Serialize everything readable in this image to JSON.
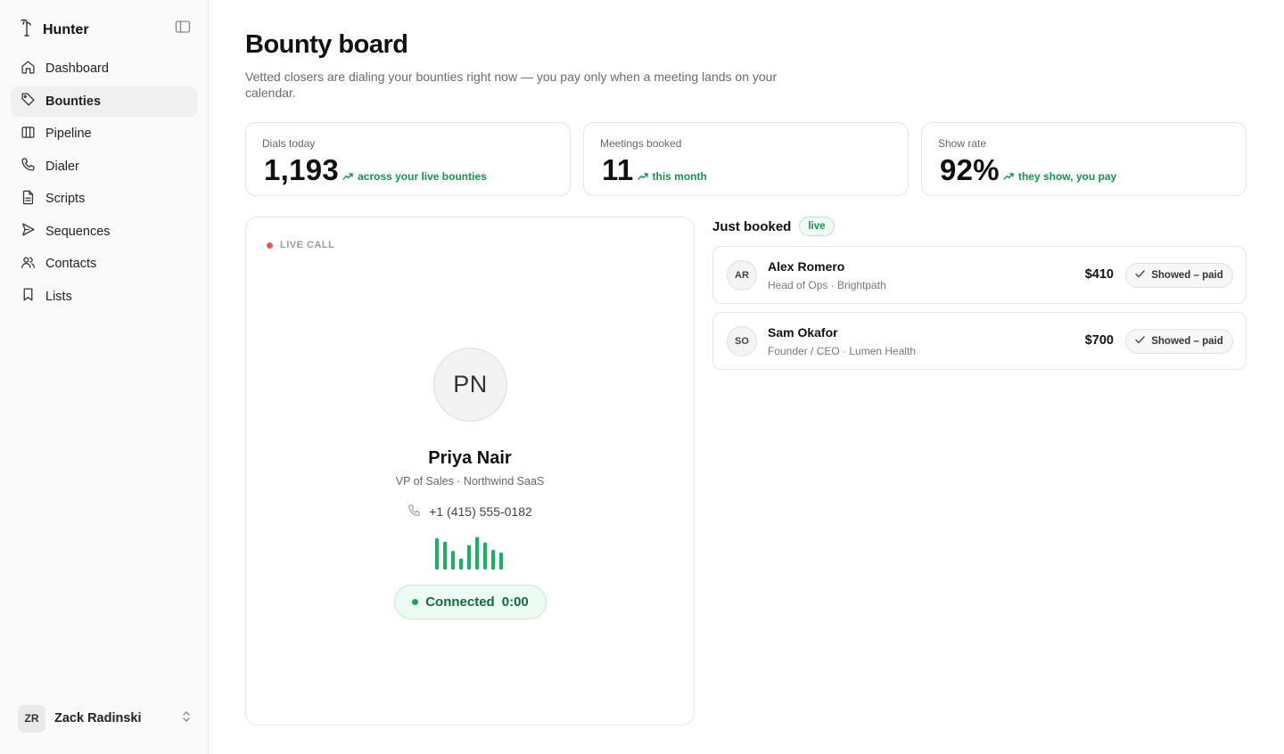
{
  "sidebar": {
    "brand": "Hunter",
    "items": [
      {
        "label": "Dashboard",
        "icon": "home-icon"
      },
      {
        "label": "Bounties",
        "icon": "tag-icon",
        "active": true
      },
      {
        "label": "Pipeline",
        "icon": "columns-icon"
      },
      {
        "label": "Dialer",
        "icon": "phone-icon"
      },
      {
        "label": "Scripts",
        "icon": "file-icon"
      },
      {
        "label": "Sequences",
        "icon": "send-icon"
      },
      {
        "label": "Contacts",
        "icon": "users-icon"
      },
      {
        "label": "Lists",
        "icon": "bookmark-icon"
      }
    ],
    "user": {
      "initials": "ZR",
      "name": "Zack Radinski"
    }
  },
  "header": {
    "title": "Bounty board",
    "subtitle": "Vetted closers are dialing your bounties right now — you pay only when a meeting lands on your calendar."
  },
  "stats": [
    {
      "label": "Dials today",
      "value": "1,193",
      "note": "across your live bounties"
    },
    {
      "label": "Meetings booked",
      "value": "11",
      "note": "this month"
    },
    {
      "label": "Show rate",
      "value": "92%",
      "note": "they show, you pay"
    }
  ],
  "live_call": {
    "label": "LIVE CALL",
    "initials": "PN",
    "name": "Priya Nair",
    "role": "VP of Sales · Northwind SaaS",
    "phone": "+1 (415) 555-0182",
    "status": "Connected",
    "timer": "0:00",
    "waveform_levels": [
      0.92,
      0.82,
      0.55,
      0.32,
      0.72,
      0.96,
      0.8,
      0.58,
      0.5
    ]
  },
  "booked": {
    "title": "Just booked",
    "badge": "live",
    "rows": [
      {
        "initials": "AR",
        "name": "Alex Romero",
        "sub": "Head of Ops · Brightpath",
        "amount": "$410",
        "status": "Showed – paid"
      },
      {
        "initials": "SO",
        "name": "Sam Okafor",
        "sub": "Founder / CEO · Lumen Health",
        "amount": "$700",
        "status": "Showed – paid"
      }
    ]
  },
  "colors": {
    "accent_green": "#17934f",
    "waveform_green": "#1fae68",
    "live_red": "#e35a5a"
  }
}
